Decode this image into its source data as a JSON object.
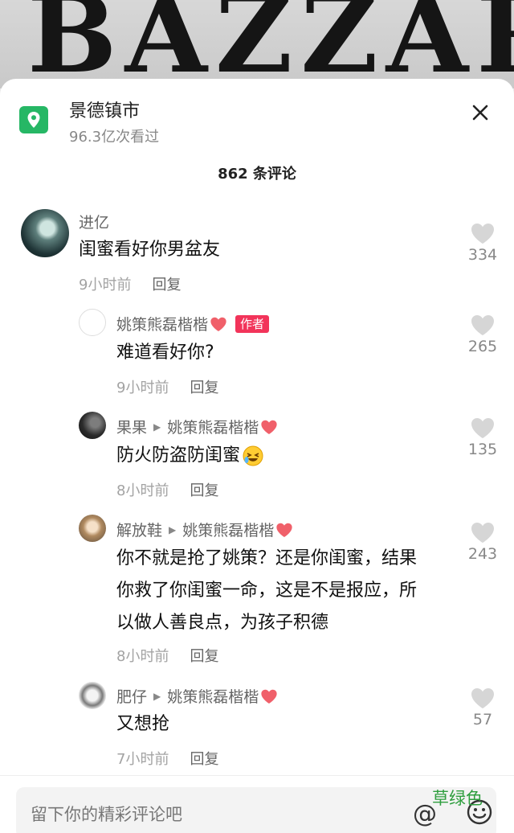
{
  "background": {
    "logo_text": "BAZZAR"
  },
  "location": {
    "title": "景德镇市",
    "views": "96.3亿次看过"
  },
  "comments_header": {
    "count_label": "862 条评论"
  },
  "comments": [
    {
      "user": "进亿",
      "text": "闺蜜看好你男盆友",
      "time": "9小时前",
      "reply": "回复",
      "likes": "334"
    },
    {
      "user": "姚策熊磊楷楷",
      "badge": "作者",
      "text": "难道看好你?",
      "time": "9小时前",
      "reply": "回复",
      "likes": "265"
    },
    {
      "user": "果果",
      "reply_to": "姚策熊磊楷楷",
      "text": "防火防盗防闺蜜",
      "time": "8小时前",
      "reply": "回复",
      "likes": "135"
    },
    {
      "user": "解放鞋",
      "reply_to": "姚策熊磊楷楷",
      "text_lines": [
        "你不就是抢了姚策？还是你闺蜜，结果",
        "你救了你闺蜜一命，这是不是报应，所",
        "以做人善良点，为孩子积德"
      ],
      "time": "8小时前",
      "reply": "回复",
      "likes": "243"
    },
    {
      "user": "肥仔",
      "reply_to": "姚策熊磊楷楷",
      "text": "又想抢",
      "time": "7小时前",
      "reply": "回复",
      "likes": "57"
    }
  ],
  "input": {
    "placeholder": "留下你的精彩评论吧",
    "at_symbol": "@"
  },
  "watermark": "草绿色",
  "colors": {
    "accent_green": "#26b765",
    "badge_red": "#f2345a",
    "heart_grey": "#d6d6d6",
    "heart_red": "#f0606a"
  }
}
